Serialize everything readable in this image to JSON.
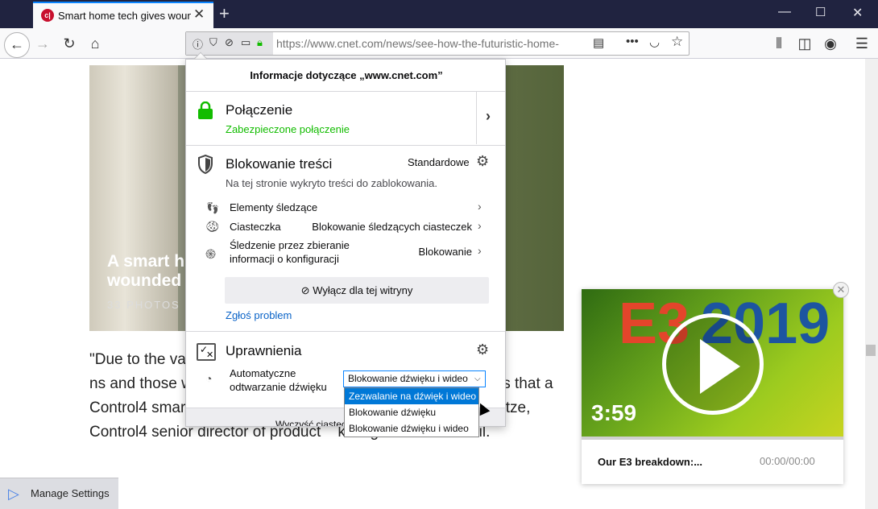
{
  "browser": {
    "tab": {
      "title": "Smart home tech gives wounded",
      "favicon": "c|",
      "close": "✕"
    },
    "newtab": "+",
    "window": {
      "minimize": "—",
      "maximize": "☐",
      "close": "✕"
    },
    "url_display": "https://www.cnet.com/news/see-how-the-futuristic-home-",
    "nav_icons": [
      "back-icon",
      "forward-icon",
      "reload-icon",
      "home-icon"
    ],
    "toolbar_icons": [
      "reader-view-icon",
      "page-actions-icon",
      "pocket-icon",
      "bookmark-star-icon",
      "library-icon",
      "sidebar-icon",
      "account-icon",
      "menu-icon"
    ]
  },
  "page": {
    "hero": {
      "title": "A smart h\nwounded",
      "subtitle": "33 PHOTOS"
    },
    "article": "\"Due to the va                                        of Control4, our                                        ns and those who use                                        eeing the ways that a Control4 smart home            just the smallest ways,\" Brad Hintze, Control4 senior director of product    keting said over email.",
    "manage_settings": "Manage Settings",
    "video": {
      "title": "Our E3 breakdown:...",
      "time": "00:00/00:00",
      "duration": "3:59",
      "brand_left": "E3",
      "brand_right": "2019",
      "close": "✕"
    }
  },
  "popup": {
    "title": "Informacje dotyczące „www.cnet.com”",
    "connection": {
      "title": "Połączenie",
      "status": "Zabezpieczone połączenie",
      "status_color": "#12bc00"
    },
    "blocking": {
      "title": "Blokowanie treści",
      "mode": "Standardowe",
      "description": "Na tej stronie wykryto treści do zablokowania.",
      "rows": [
        {
          "icon": "footprints-icon",
          "label": "Elementy śledzące",
          "value": ""
        },
        {
          "icon": "cookie-icon",
          "label": "Ciasteczka",
          "value": "Blokowanie śledzących ciasteczek"
        },
        {
          "icon": "fingerprint-icon",
          "label": "Śledzenie przez zbieranie informacji o konfiguracji",
          "value": "Blokowanie"
        }
      ],
      "disable_button": "Wyłącz dla tej witryny",
      "report": "Zgłoś problem"
    },
    "permissions": {
      "title": "Uprawnienia",
      "autoplay_label": "Automatyczne odtwarzanie dźwięku",
      "autoplay_value": "Blokowanie dźwięku i wideo",
      "options": [
        "Zezwalanie na dźwięk i wideo",
        "Blokowanie dźwięku",
        "Blokowanie dźwięku i wideo"
      ]
    },
    "footer": "Wyczyść ciasteczka"
  }
}
